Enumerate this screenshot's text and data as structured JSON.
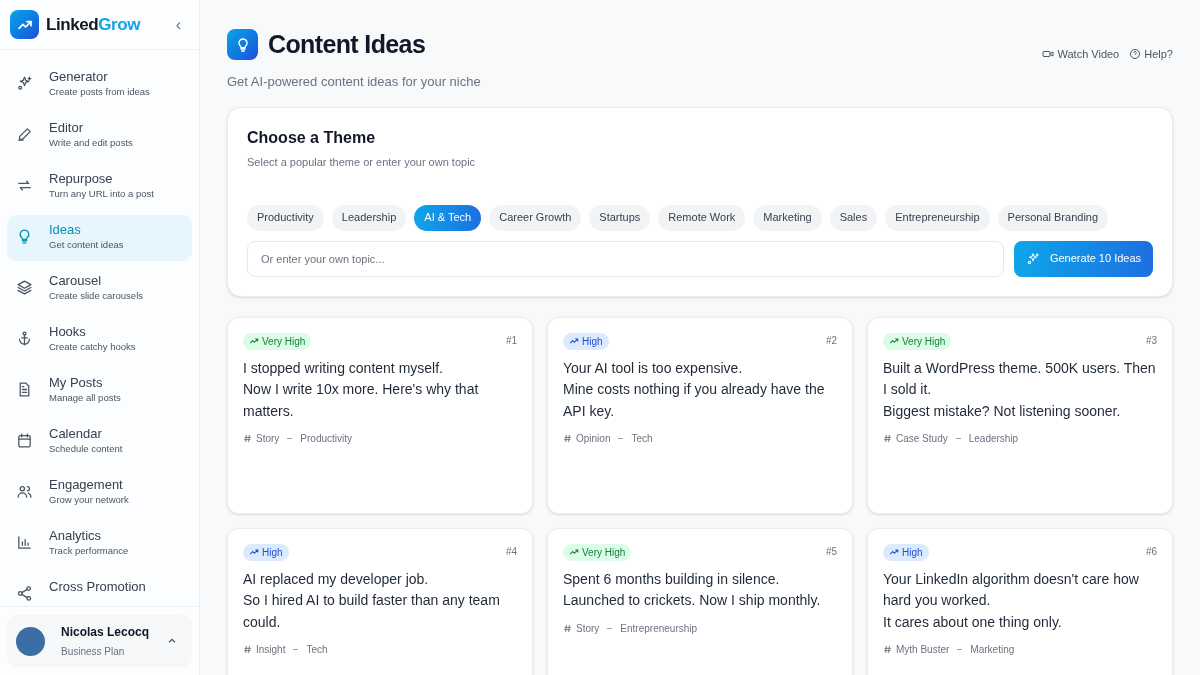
{
  "sidebar": {
    "brand": {
      "part1": "Linked",
      "part2": "Grow"
    },
    "collapse": "‹",
    "items": [
      {
        "kind": "sparkles",
        "title": "Generator",
        "subtitle": "Create posts from ideas",
        "selected": false
      },
      {
        "kind": "pen",
        "title": "Editor",
        "subtitle": "Write and edit posts",
        "selected": false
      },
      {
        "kind": "repeat",
        "title": "Repurpose",
        "subtitle": "Turn any URL into a post",
        "selected": false
      },
      {
        "kind": "bulb",
        "title": "Ideas",
        "subtitle": "Get content ideas",
        "selected": true
      },
      {
        "kind": "layers",
        "title": "Carousel",
        "subtitle": "Create slide carousels",
        "selected": false
      },
      {
        "kind": "anchor",
        "title": "Hooks",
        "subtitle": "Create catchy hooks",
        "selected": false
      },
      {
        "kind": "file",
        "title": "My Posts",
        "subtitle": "Manage all posts",
        "selected": false
      },
      {
        "kind": "calendar",
        "title": "Calendar",
        "subtitle": "Schedule content",
        "selected": false
      },
      {
        "kind": "users",
        "title": "Engagement",
        "subtitle": "Grow your network",
        "selected": false
      },
      {
        "kind": "chart",
        "title": "Analytics",
        "subtitle": "Track performance",
        "selected": false
      },
      {
        "kind": "share",
        "title": "Cross Promotion",
        "selected": false
      }
    ],
    "user": {
      "name": "Nicolas Lecocq",
      "plan": "Business Plan"
    }
  },
  "header": {
    "title": "Content Ideas",
    "subtitle": "Get AI-powered content ideas for your niche",
    "links": [
      "Watch Video",
      "Help?"
    ]
  },
  "theme_panel": {
    "title": "Choose a Theme",
    "subtitle": "Select a popular theme or enter your own topic",
    "themes": [
      {
        "label": "Productivity",
        "selected": false
      },
      {
        "label": "Leadership",
        "selected": false
      },
      {
        "label": "AI & Tech",
        "selected": true
      },
      {
        "label": "Career Growth",
        "selected": false
      },
      {
        "label": "Startups",
        "selected": false
      },
      {
        "label": "Remote Work",
        "selected": false
      },
      {
        "label": "Marketing",
        "selected": false
      },
      {
        "label": "Sales",
        "selected": false
      },
      {
        "label": "Entrepreneurship",
        "selected": false
      },
      {
        "label": "Personal Branding",
        "selected": false
      }
    ],
    "topic_placeholder": "Or enter your own topic...",
    "generate_button": "Generate 10 Ideas"
  },
  "ideas": [
    {
      "kind": "very_high",
      "badge": "Very High",
      "number": "#1",
      "lines": [
        "I stopped writing content myself.",
        "Now I write 10x more. Here's why that matters."
      ],
      "type": "Story",
      "category": "Productivity"
    },
    {
      "kind": "high",
      "badge": "High",
      "number": "#2",
      "lines": [
        "Your AI tool is too expensive.",
        "Mine costs nothing if you already have the API key."
      ],
      "type": "Opinion",
      "category": "Tech"
    },
    {
      "kind": "very_high",
      "badge": "Very High",
      "number": "#3",
      "lines": [
        "Built a WordPress theme. 500K users. Then I sold it.",
        "Biggest mistake? Not listening sooner."
      ],
      "type": "Case Study",
      "category": "Leadership"
    },
    {
      "kind": "high",
      "badge": "High",
      "number": "#4",
      "lines": [
        "AI replaced my developer job.",
        "So I hired AI to build faster than any team could."
      ],
      "type": "Insight",
      "category": "Tech"
    },
    {
      "kind": "very_high",
      "badge": "Very High",
      "number": "#5",
      "lines": [
        "Spent 6 months building in silence.",
        "Launched to crickets. Now I ship monthly."
      ],
      "type": "Story",
      "category": "Entrepreneurship"
    },
    {
      "kind": "high",
      "badge": "High",
      "number": "#6",
      "lines": [
        "Your LinkedIn algorithm doesn't care how hard you worked.",
        "It cares about one thing only."
      ],
      "type": "Myth Buster",
      "category": "Marketing"
    }
  ]
}
